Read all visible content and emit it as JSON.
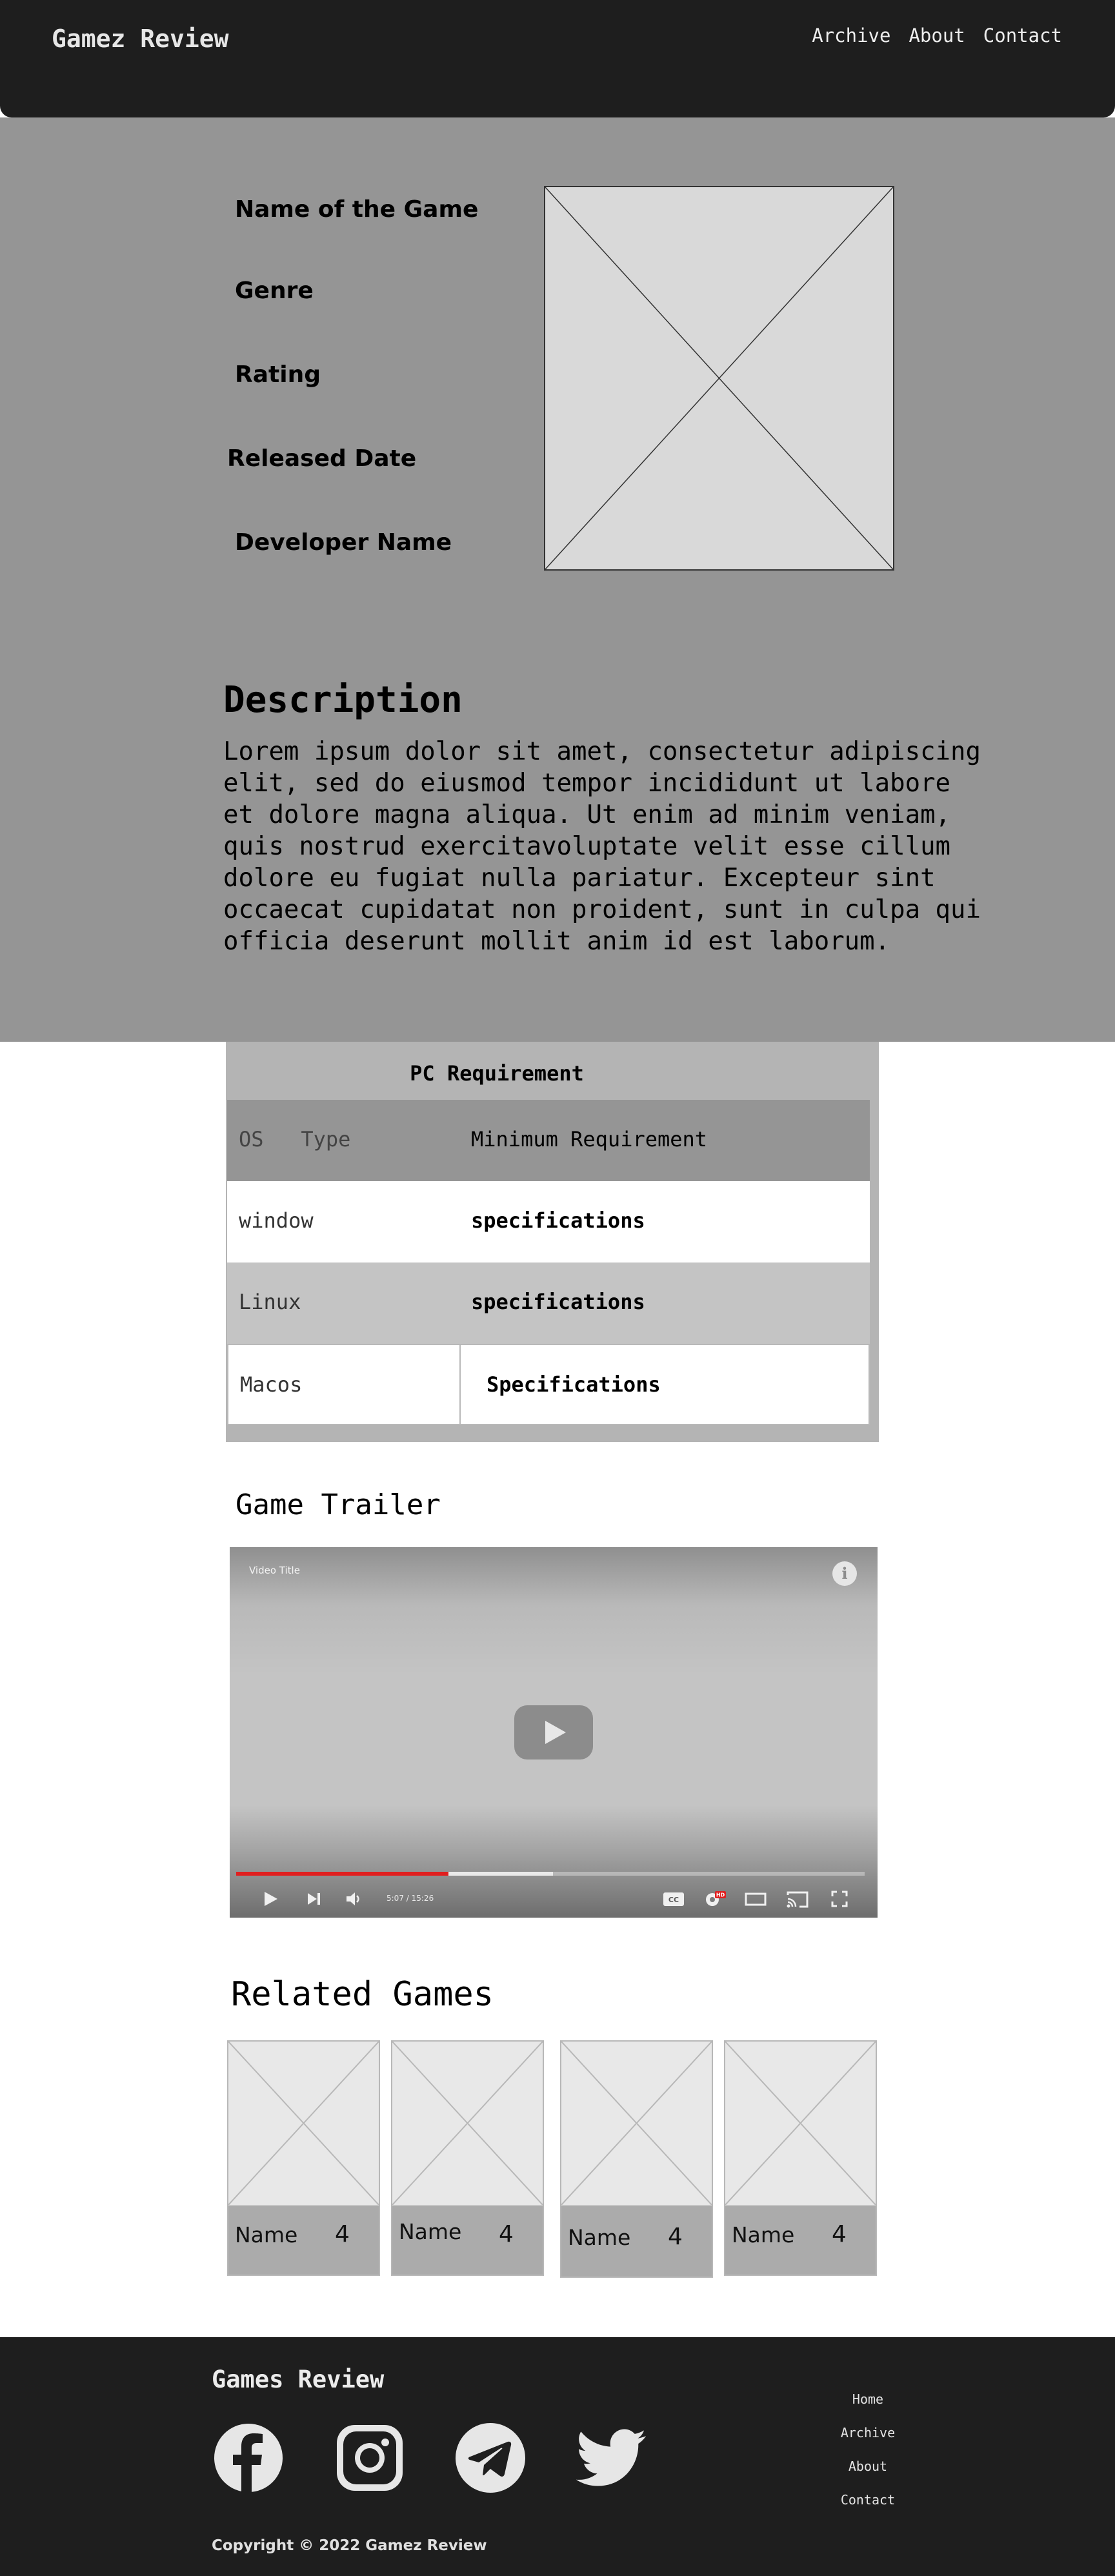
{
  "header": {
    "brand": "Gamez Review",
    "nav": [
      "Archive",
      "About",
      "Contact"
    ]
  },
  "game": {
    "name_label": "Name of the Game",
    "genre_label": "Genre",
    "rating_label": "Rating",
    "released_label": "Released Date",
    "developer_label": "Developer Name"
  },
  "description": {
    "title": "Description",
    "body": "Lorem ipsum dolor sit amet, consectetur adipiscing elit, sed do eiusmod tempor incididunt ut labore et dolore magna aliqua. Ut enim ad minim veniam, quis nostrud exercitavoluptate velit esse cillum dolore eu fugiat nulla pariatur. Excepteur sint occaecat cupidatat non proident, sunt in culpa qui officia deserunt mollit anim id est laborum."
  },
  "requirements": {
    "title": "PC Requirement",
    "header": {
      "os": "OS   Type",
      "min": "Minimum Requirement"
    },
    "rows": [
      {
        "os": "window",
        "spec": "specifications"
      },
      {
        "os": "Linux",
        "spec": "specifications"
      },
      {
        "os": "Macos",
        "spec": "Specifications"
      }
    ]
  },
  "trailer": {
    "title": "Game Trailer",
    "video_title": "Video Title",
    "time": "5:07 / 15:26",
    "progress": 0.338,
    "buffered": 0.504,
    "colors": {
      "progress": "#e01f1f"
    }
  },
  "related": {
    "title": "Related Games",
    "cards": [
      {
        "name": "Name",
        "score": "4"
      },
      {
        "name": "Name",
        "score": "4"
      },
      {
        "name": "Name",
        "score": "4"
      },
      {
        "name": "Name",
        "score": "4"
      }
    ]
  },
  "footer": {
    "title": "Games Review",
    "links": [
      "Home",
      "Archive",
      "About",
      "Contact"
    ],
    "copyright": "Copyright © 2022 Gamez Review",
    "social_icons": [
      "facebook-icon",
      "instagram-icon",
      "telegram-icon",
      "twitter-icon"
    ]
  }
}
